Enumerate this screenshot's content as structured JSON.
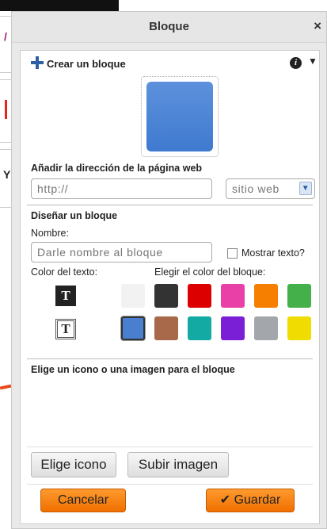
{
  "dialog": {
    "title": "Bloque",
    "close_symbol": "×"
  },
  "header": {
    "label": "Crear un bloque",
    "info_symbol": "i",
    "caret_symbol": "▼"
  },
  "preview": {
    "color": "#3f7ad0"
  },
  "web": {
    "title": "Añadir la dirección de la página web",
    "url_placeholder": "http://",
    "site_type_selected": "sitio web",
    "select_arrow": "▼"
  },
  "design": {
    "title": "Diseñar un bloque",
    "name_label": "Nombre:",
    "name_placeholder": "Darle nombre al bloque",
    "show_text_label": "Mostrar texto?",
    "text_color_label": "Color del texto:",
    "block_color_label": "Elegir el color del bloque:",
    "text_glyph": "T",
    "swatches_row1": [
      "#f2f2f2",
      "#333333",
      "#dd0000",
      "#e940a8",
      "#f77f00",
      "#44b04a"
    ],
    "swatches_row2": [
      "#4a7fd0",
      "#a7694a",
      "#12aaa2",
      "#7a1fd6",
      "#a3a6ab",
      "#f0dc00"
    ]
  },
  "icon_section": {
    "title": "Elige un icono o una imagen para el bloque",
    "choose_icon_button": "Elige icono",
    "upload_image_button": "Subir imagen"
  },
  "footer": {
    "cancel_button": "Cancelar",
    "save_button": "Guardar",
    "save_check": "✔"
  },
  "background": {
    "glyph_y": "Y"
  }
}
